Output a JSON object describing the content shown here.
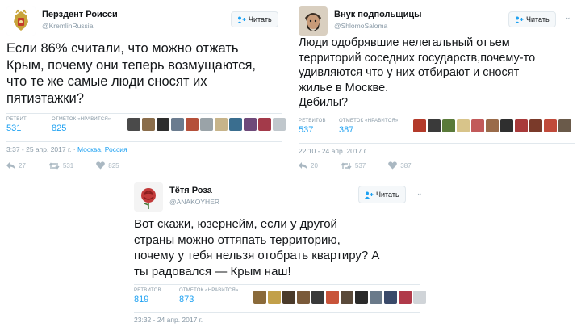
{
  "tweets": [
    {
      "name": "Перздент Роисси",
      "handle": "@KremlinRussia",
      "follow_label": "Читать",
      "text_lines": [
        "Если 86% считали, что можно отжать",
        "Крым, почему они теперь возмущаются,",
        "что те же самые люди сносят их",
        "пятиэтажки?"
      ],
      "retweets_label": "РЕТВИТ",
      "retweets": "531",
      "likes_label": "ОТМЕТОК «НРАВИТСЯ»",
      "likes": "825",
      "timestamp": "3:37 - 25 апр. 2017 г.",
      "location": "Москва, Россия",
      "reply_count": "27",
      "retweet_count": "531",
      "like_count": "825",
      "liker_colors": [
        "#4a4a4a",
        "#8a6d4b",
        "#2d2d2d",
        "#6b7c8f",
        "#b5503a",
        "#9aa3a8",
        "#c7b48a",
        "#3a6e8f",
        "#6e4a7a",
        "#a33a4a",
        "#c0c7cc"
      ]
    },
    {
      "name": "Внук подпольщицы",
      "handle": "@ShlomoSaloma",
      "follow_label": "Читать",
      "text_lines": [
        "Люди одобрявшие нелегальный отъем",
        "территорий соседних государств,почему-то",
        "удивляются что у них отбирают и сносят",
        "жилье в Москве.",
        "Дебилы?"
      ],
      "retweets_label": "РЕТВИТОВ",
      "retweets": "537",
      "likes_label": "ОТМЕТОК «НРАВИТСЯ»",
      "likes": "387",
      "timestamp": "22:10 - 24 апр. 2017 г.",
      "reply_count": "20",
      "retweet_count": "537",
      "like_count": "387",
      "liker_colors": [
        "#b33a2a",
        "#3a3a3a",
        "#5a7a3a",
        "#d8c48a",
        "#c25a5a",
        "#9a6b4a",
        "#2f2f2f",
        "#a83a3a",
        "#7a3a2a",
        "#c04a3a",
        "#6a5a4a"
      ]
    },
    {
      "name": "Тётя Роза",
      "handle": "@ANAKOYHER",
      "follow_label": "Читать",
      "text_lines": [
        "Вот скажи, юзернейм, если у другой",
        "страны можно оттяпать территорию,",
        "почему у тебя нельзя отобрать квартиру? А",
        "ты радовался — Крым наш!"
      ],
      "retweets_label": "РЕТВИТОВ",
      "retweets": "819",
      "likes_label": "ОТМЕТОК «НРАВИТСЯ»",
      "likes": "873",
      "timestamp": "23:32 - 24 апр. 2017 г.",
      "liker_colors": [
        "#8a6a3a",
        "#c2a04a",
        "#4a3a2a",
        "#7a5a3a",
        "#3a3a3a",
        "#c8543a",
        "#5a4a3a",
        "#2a2a2a",
        "#6a7a8a",
        "#3a4a6a",
        "#b03a4a",
        "#d0d4d8"
      ]
    }
  ],
  "colors": {
    "link_blue": "#1da1f2",
    "meta_gray": "#8899a6",
    "border": "#e1e8ed"
  },
  "icons": {
    "follow": "follow-person-plus-icon",
    "chevron": "chevron-down-icon",
    "reply": "reply-icon",
    "retweet": "retweet-icon",
    "like": "heart-icon",
    "avatar_1": "coat-of-arms-avatar",
    "avatar_2": "bearded-man-avatar",
    "avatar_3": "rose-avatar"
  }
}
